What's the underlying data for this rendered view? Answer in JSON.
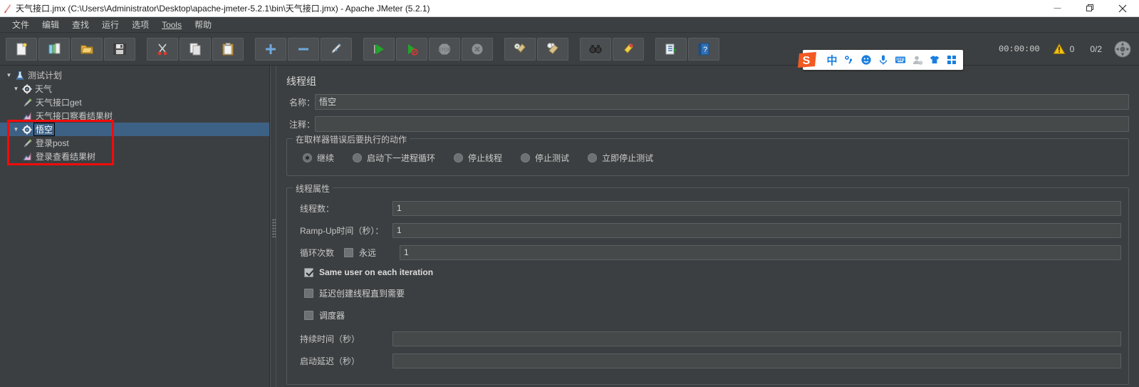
{
  "window": {
    "title": "天气接口.jmx (C:\\Users\\Administrator\\Desktop\\apache-jmeter-5.2.1\\bin\\天气接口.jmx) - Apache JMeter (5.2.1)",
    "app_icon": "jmeter-feather-icon",
    "controls": {
      "minimize": "minimize-icon",
      "maximize": "maximize-icon",
      "close": "close-icon"
    }
  },
  "menubar": {
    "items": [
      {
        "label": "文件",
        "name": "menu-file"
      },
      {
        "label": "编辑",
        "name": "menu-edit"
      },
      {
        "label": "查找",
        "name": "menu-search"
      },
      {
        "label": "运行",
        "name": "menu-run"
      },
      {
        "label": "选项",
        "name": "menu-options"
      },
      {
        "label": "Tools",
        "name": "menu-tools",
        "mnemonic": "T"
      },
      {
        "label": "帮助",
        "name": "menu-help"
      }
    ]
  },
  "toolbar": {
    "buttons": [
      {
        "name": "new-button",
        "icon": "new-document-icon"
      },
      {
        "name": "templates-button",
        "icon": "templates-icon"
      },
      {
        "name": "open-button",
        "icon": "open-folder-icon"
      },
      {
        "name": "save-button",
        "icon": "save-floppy-icon"
      },
      {
        "name": "cut-button",
        "icon": "scissors-icon"
      },
      {
        "name": "copy-button",
        "icon": "copy-icon"
      },
      {
        "name": "paste-button",
        "icon": "clipboard-paste-icon"
      },
      {
        "name": "expand-all-button",
        "icon": "plus-icon"
      },
      {
        "name": "collapse-all-button",
        "icon": "minus-icon"
      },
      {
        "name": "toggle-button",
        "icon": "toggle-pencil-icon"
      },
      {
        "name": "start-button",
        "icon": "green-play-icon"
      },
      {
        "name": "start-no-pauses-button",
        "icon": "green-play-no-pause-icon"
      },
      {
        "name": "stop-button",
        "icon": "stop-octagon-icon"
      },
      {
        "name": "shutdown-button",
        "icon": "shutdown-circle-icon"
      },
      {
        "name": "clear-button",
        "icon": "clear-broom-icon"
      },
      {
        "name": "clear-all-button",
        "icon": "clear-all-broom-icon"
      },
      {
        "name": "search-button",
        "icon": "binoculars-icon"
      },
      {
        "name": "reset-search-button",
        "icon": "reset-broom-icon"
      },
      {
        "name": "function-helper-button",
        "icon": "function-list-icon"
      },
      {
        "name": "help-button",
        "icon": "help-book-icon"
      }
    ],
    "status": {
      "elapsed": "00:00:00",
      "warning_icon": "warning-triangle-icon",
      "warning_count": "0",
      "threads_ratio": "0/2",
      "reset_icon": "reset-gauge-icon"
    }
  },
  "ime": {
    "name": "sogou-ime-toolbar",
    "logo": "sogou-s-logo",
    "items": [
      {
        "name": "ime-language-mode",
        "glyph": "中"
      },
      {
        "name": "ime-punctuation-mode",
        "glyph": "°,"
      },
      {
        "name": "ime-emoji",
        "glyph": "☺"
      },
      {
        "name": "ime-voice-input",
        "glyph": "🎤"
      },
      {
        "name": "ime-soft-keyboard",
        "glyph": "⌨"
      },
      {
        "name": "ime-user-account",
        "glyph": "👤"
      },
      {
        "name": "ime-skin",
        "glyph": "👕"
      },
      {
        "name": "ime-toolbox",
        "glyph": "▦"
      }
    ]
  },
  "tree": {
    "nodes": [
      {
        "label": "测试计划",
        "icon": "test-plan-icon",
        "level": 0,
        "expanded": true,
        "selected": false,
        "name": "tree-node-test-plan"
      },
      {
        "label": "天气",
        "icon": "thread-group-icon",
        "level": 1,
        "expanded": true,
        "selected": false,
        "name": "tree-node-weather-group"
      },
      {
        "label": "天气接口get",
        "icon": "http-sampler-icon",
        "level": 2,
        "expanded": null,
        "selected": false,
        "name": "tree-node-weather-get"
      },
      {
        "label": "天气接口察看结果树",
        "icon": "view-results-tree-icon",
        "level": 2,
        "expanded": null,
        "selected": false,
        "name": "tree-node-weather-results"
      },
      {
        "label": "悟空",
        "icon": "thread-group-icon",
        "level": 1,
        "expanded": true,
        "selected": true,
        "name": "tree-node-wukong-group"
      },
      {
        "label": "登录post",
        "icon": "http-sampler-icon",
        "level": 2,
        "expanded": null,
        "selected": false,
        "name": "tree-node-login-post"
      },
      {
        "label": "登录查看结果树",
        "icon": "view-results-tree-icon",
        "level": 2,
        "expanded": null,
        "selected": false,
        "name": "tree-node-login-results"
      }
    ],
    "annotation": {
      "name": "red-highlight-box",
      "color": "#f40b0b"
    }
  },
  "panel": {
    "title": "线程组",
    "name_label": "名称：",
    "name_value": "悟空",
    "comment_label": "注释：",
    "comment_value": "",
    "error_action": {
      "legend": "在取样器错误后要执行的动作",
      "options": [
        {
          "label": "继续",
          "selected": true,
          "name": "radio-continue"
        },
        {
          "label": "启动下一进程循环",
          "selected": false,
          "name": "radio-start-next-loop"
        },
        {
          "label": "停止线程",
          "selected": false,
          "name": "radio-stop-thread"
        },
        {
          "label": "停止测试",
          "selected": false,
          "name": "radio-stop-test"
        },
        {
          "label": "立即停止测试",
          "selected": false,
          "name": "radio-stop-test-now"
        }
      ]
    },
    "thread_properties": {
      "legend": "线程属性",
      "num_threads_label": "线程数：",
      "num_threads_value": "1",
      "ramp_up_label": "Ramp-Up时间（秒）：",
      "ramp_up_value": "1",
      "loop_label": "循环次数",
      "loop_forever_label": "永远",
      "loop_forever_checked": false,
      "loop_value": "1",
      "same_user_label": "Same user on each iteration",
      "same_user_checked": true,
      "delay_thread_label": "延迟创建线程直到需要",
      "delay_thread_checked": false,
      "scheduler_label": "调度器",
      "scheduler_checked": false,
      "duration_label": "持续时间（秒）",
      "duration_value": "",
      "startup_delay_label": "启动延迟（秒）",
      "startup_delay_value": ""
    }
  }
}
